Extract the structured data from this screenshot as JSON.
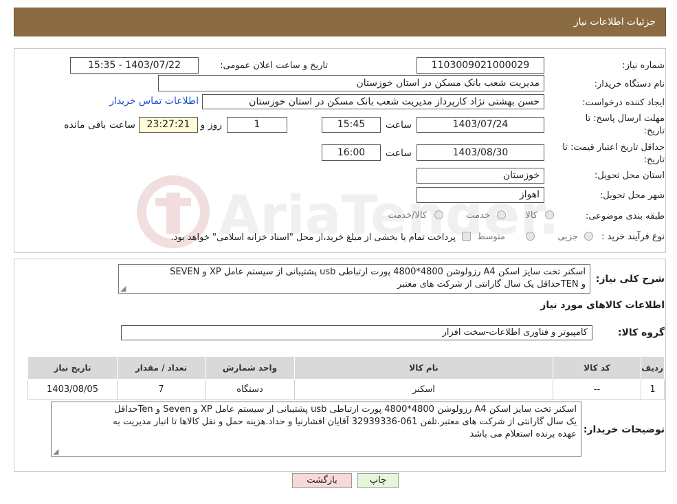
{
  "header": {
    "title": "جزئیات اطلاعات نیاز"
  },
  "details": {
    "need_number_label": "شماره نیاز:",
    "need_number": "1103009021000029",
    "announce_label": "تاریخ و ساعت اعلان عمومی:",
    "announce_value": "1403/07/22 - 15:35",
    "buyer_org_label": "نام دستگاه خریدار:",
    "buyer_org": "مدیریت شعب بانک مسکن در استان خوزستان",
    "requester_label": "ایجاد کننده درخواست:",
    "requester": "حسن بهشتی نژاد کارپرداز مدیریت شعب بانک مسکن در استان خوزستان",
    "contact_link": "اطلاعات تماس خریدار",
    "deadline_label_1": "مهلت ارسال پاسخ: تا",
    "deadline_label_2": "تاریخ:",
    "deadline_date": "1403/07/24",
    "time_label": "ساعت",
    "deadline_time": "15:45",
    "days_value": "1",
    "days_label": "روز و",
    "remaining_time": "23:27:21",
    "remaining_label": "ساعت باقی مانده",
    "validity_label_1": "حداقل تاریخ اعتبار قیمت: تا",
    "validity_label_2": "تاریخ:",
    "validity_date": "1403/08/30",
    "validity_time": "16:00",
    "province_label": "استان محل تحویل:",
    "province": "خوزستان",
    "city_label": "شهر محل تحویل:",
    "city": "اهواز",
    "category_label": "طبقه بندی موضوعی:",
    "category_options": [
      "کالا",
      "خدمت",
      "کالا/خدمت"
    ],
    "process_label": "نوع فرآیند خرید :",
    "process_options": [
      "جزیی",
      "متوسط"
    ],
    "payment_note": "پرداخت تمام یا بخشی از مبلغ خرید،از محل \"اسناد خزانه اسلامی\" خواهد بود."
  },
  "summary": {
    "label": "شرح کلی نیاز:",
    "text_line1": "اسکنر تخت سایز اسکن A4 رزولوشن 4800*4800 پورت ارتباطی usb پشتیبانی از سیستم عامل XP و SEVEN",
    "text_line2": "و TENحداقل یک سال گارانتی از شرکت های معتبر",
    "items_heading": "اطلاعات کالاهای مورد نیاز",
    "group_label": "گروه کالا:",
    "group_value": "کامپیوتر و فناوری اطلاعات-سخت افزار"
  },
  "table": {
    "headers": [
      "ردیف",
      "کد کالا",
      "نام کالا",
      "واحد شمارش",
      "تعداد / مقدار",
      "تاریخ نیاز"
    ],
    "rows": [
      [
        "1",
        "--",
        "اسکنر",
        "دستگاه",
        "7",
        "1403/08/05"
      ]
    ]
  },
  "buyer_notes": {
    "label": "توضیحات خریدار:",
    "line1": "اسکنر تخت سایز اسکن A4 رزولوشن 4800*4800 پورت ارتباطی usb پشتیبانی از سیستم عامل XP و  Seven و Tenحداقل",
    "line2": "یک سال گارانتی از شرکت های معتبر.تلفن 061-32939336 آقایان افشارنیا و حداد.هزینه حمل و نقل کالاها تا انبار مدیریت به",
    "line3": "عهده برنده استعلام می باشد"
  },
  "buttons": {
    "print": "چاپ",
    "back": "بازگشت"
  },
  "colors": {
    "header_bg": "#8b6c42",
    "yellow_field": "#fffbd6",
    "back_button": "#f8d9d9",
    "print_button": "#e6f7d9",
    "link": "#1a4fd0"
  }
}
